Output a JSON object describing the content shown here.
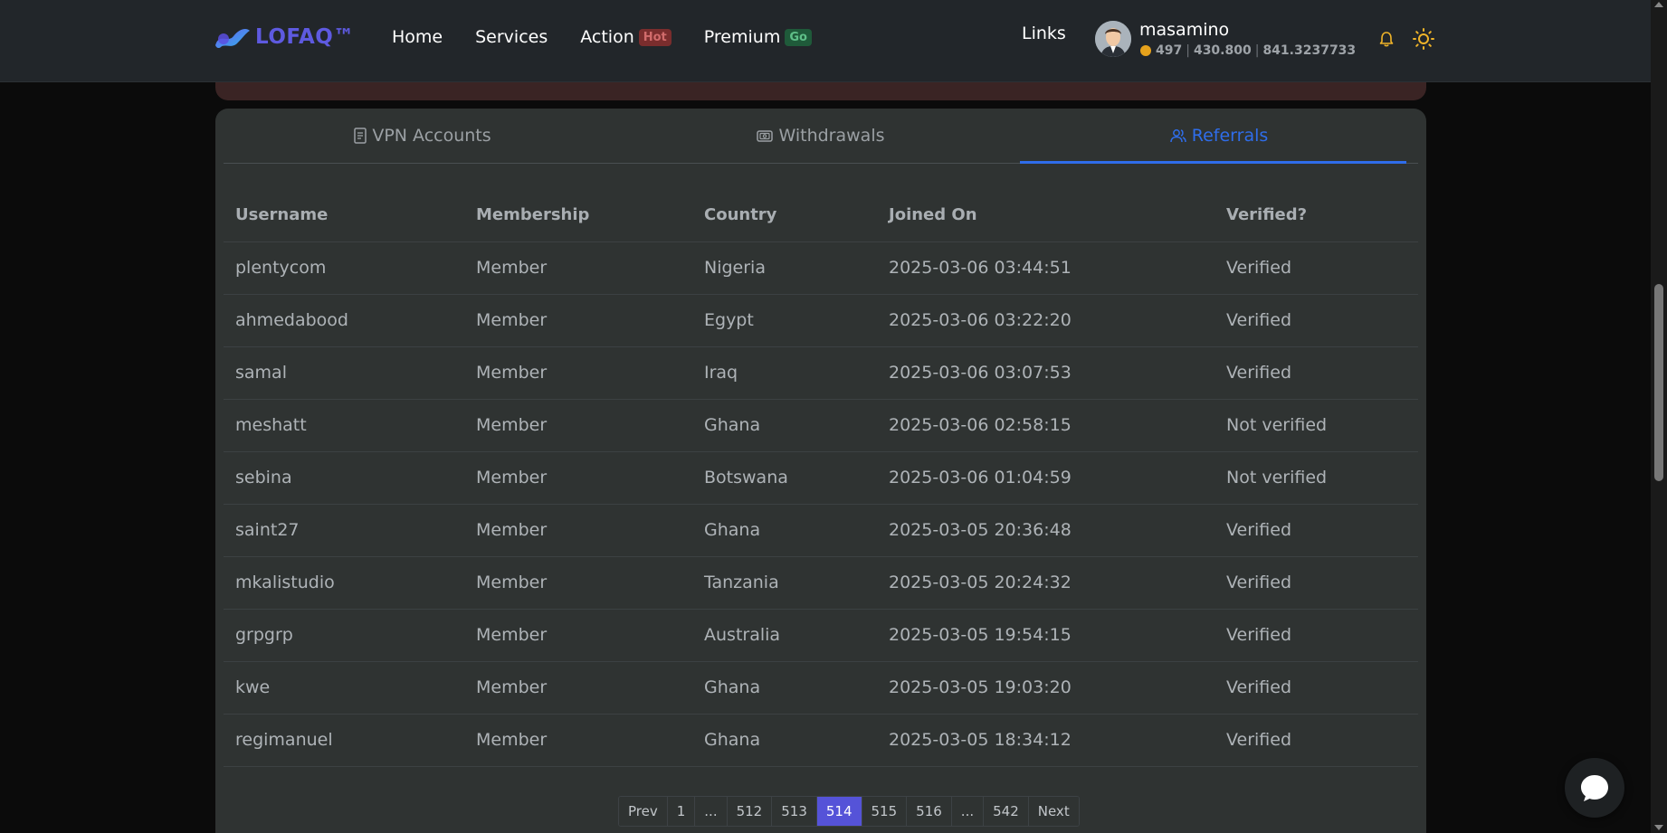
{
  "header": {
    "brand": "LOFAQ™",
    "nav": [
      {
        "label": "Home"
      },
      {
        "label": "Services"
      },
      {
        "label": "Action",
        "badge": "Hot"
      },
      {
        "label": "Premium",
        "badge": "Go"
      }
    ],
    "links_label": "Links",
    "user": {
      "name": "masamino",
      "coins": "497",
      "stat2": "430.800",
      "stat3": "841.3237733"
    }
  },
  "tabs": [
    {
      "label": "VPN Accounts",
      "icon": "document-icon"
    },
    {
      "label": "Withdrawals",
      "icon": "wallet-icon"
    },
    {
      "label": "Referrals",
      "icon": "users-icon",
      "active": true
    }
  ],
  "table": {
    "columns": [
      "Username",
      "Membership",
      "Country",
      "Joined On",
      "Verified?"
    ],
    "rows": [
      [
        "plentycom",
        "Member",
        "Nigeria",
        "2025-03-06 03:44:51",
        "Verified"
      ],
      [
        "ahmedabood",
        "Member",
        "Egypt",
        "2025-03-06 03:22:20",
        "Verified"
      ],
      [
        "samal",
        "Member",
        "Iraq",
        "2025-03-06 03:07:53",
        "Verified"
      ],
      [
        "meshatt",
        "Member",
        "Ghana",
        "2025-03-06 02:58:15",
        "Not verified"
      ],
      [
        "sebina",
        "Member",
        "Botswana",
        "2025-03-06 01:04:59",
        "Not verified"
      ],
      [
        "saint27",
        "Member",
        "Ghana",
        "2025-03-05 20:36:48",
        "Verified"
      ],
      [
        "mkalistudio",
        "Member",
        "Tanzania",
        "2025-03-05 20:24:32",
        "Verified"
      ],
      [
        "grpgrp",
        "Member",
        "Australia",
        "2025-03-05 19:54:15",
        "Verified"
      ],
      [
        "kwe",
        "Member",
        "Ghana",
        "2025-03-05 19:03:20",
        "Verified"
      ],
      [
        "regimanuel",
        "Member",
        "Ghana",
        "2025-03-05 18:34:12",
        "Verified"
      ]
    ]
  },
  "pagination": {
    "items": [
      "Prev",
      "1",
      "...",
      "512",
      "513",
      "514",
      "515",
      "516",
      "...",
      "542",
      "Next"
    ],
    "active": "514"
  },
  "colors": {
    "accent": "#2f6dea",
    "brand": "#5e5ae0",
    "page_active": "#5553d8"
  }
}
